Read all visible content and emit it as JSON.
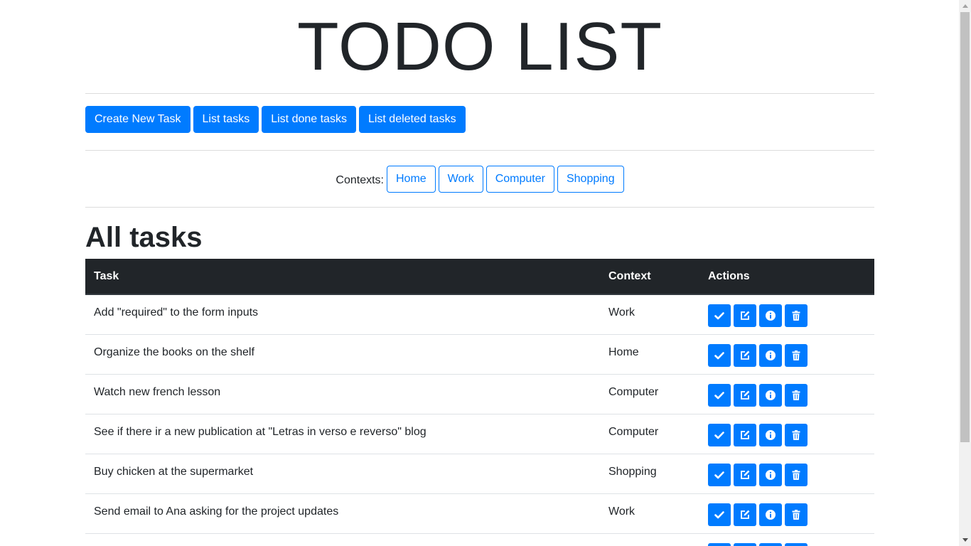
{
  "header": {
    "title": "TODO LIST"
  },
  "toolbar": {
    "create_label": "Create New Task",
    "list_label": "List tasks",
    "done_label": "List done tasks",
    "deleted_label": "List deleted tasks"
  },
  "contexts": {
    "label": "Contexts:",
    "items": [
      "Home",
      "Work",
      "Computer",
      "Shopping"
    ]
  },
  "section": {
    "title": "All tasks"
  },
  "table": {
    "headers": {
      "task": "Task",
      "context": "Context",
      "actions": "Actions"
    },
    "rows": [
      {
        "task": "Add \"required\" to the form inputs",
        "context": "Work"
      },
      {
        "task": "Organize the books on the shelf",
        "context": "Home"
      },
      {
        "task": "Watch new french lesson",
        "context": "Computer"
      },
      {
        "task": "See if there ir a new publication at \"Letras in verso e reverso\" blog",
        "context": "Computer"
      },
      {
        "task": "Buy chicken at the supermarket",
        "context": "Shopping"
      },
      {
        "task": "Send email to Ana asking for the project updates",
        "context": "Work"
      },
      {
        "task": "",
        "context": ""
      }
    ],
    "action_icons": [
      "check-icon",
      "edit-icon",
      "info-icon",
      "trash-icon"
    ]
  },
  "colors": {
    "primary": "#007bff",
    "dark": "#212529",
    "background": "#ffffff"
  }
}
